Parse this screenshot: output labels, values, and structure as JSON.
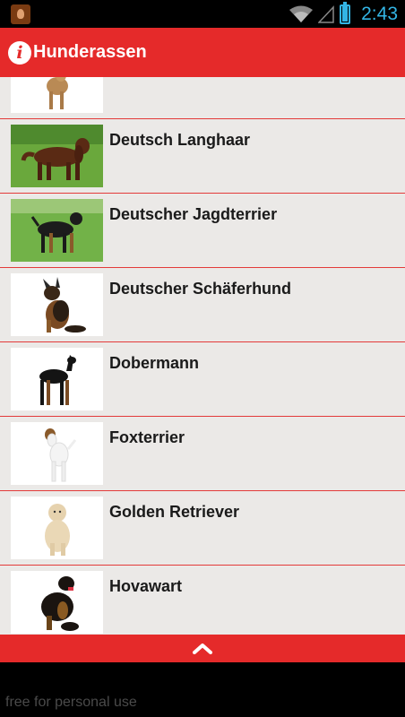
{
  "status_bar": {
    "time": "2:43",
    "battery_icon": "battery-charging-icon",
    "wifi_icon": "wifi-icon",
    "signal_icon": "signal-icon"
  },
  "action_bar": {
    "title": "Hunderassen",
    "icon": "info-icon",
    "bg_color": "#e52a2a"
  },
  "list": {
    "items": [
      {
        "name": "",
        "image": "dog-standing-tan"
      },
      {
        "name": "Deutsch Langhaar",
        "image": "dog-brown-longhair-grass"
      },
      {
        "name": "Deutscher Jagdterrier",
        "image": "dog-black-tan-grass"
      },
      {
        "name": "Deutscher Schäferhund",
        "image": "dog-shepherd-puppy"
      },
      {
        "name": "Dobermann",
        "image": "dog-doberman"
      },
      {
        "name": "Foxterrier",
        "image": "dog-foxterrier"
      },
      {
        "name": "Golden Retriever",
        "image": "dog-golden-retriever"
      },
      {
        "name": "Hovawart",
        "image": "dog-hovawart"
      }
    ]
  },
  "bottom_bar": {
    "icon": "chevron-up-icon"
  },
  "footer": {
    "text": "free for personal use"
  }
}
